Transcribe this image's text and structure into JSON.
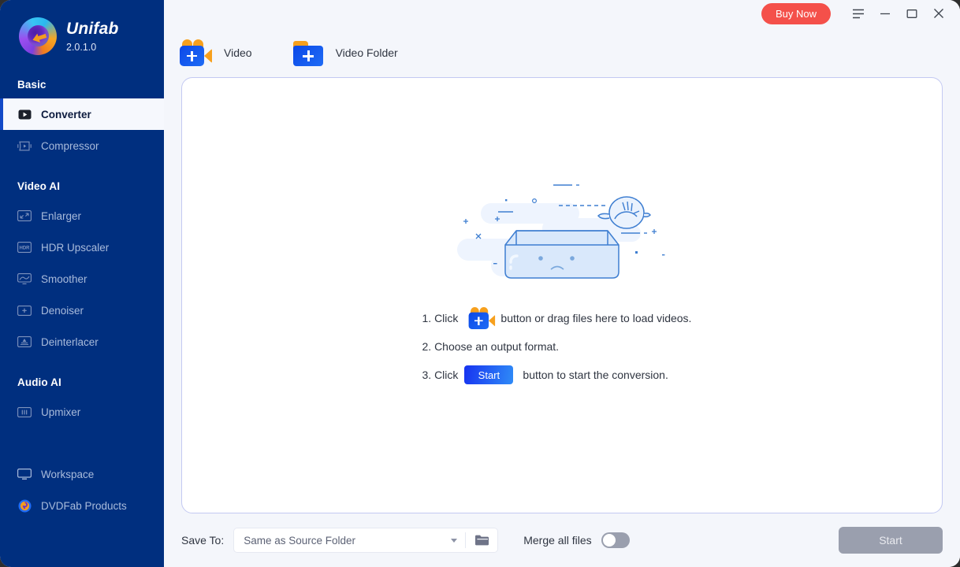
{
  "app": {
    "name": "Unifab",
    "version": "2.0.1.0"
  },
  "titlebar": {
    "buy_now_label": "Buy Now",
    "menu_icon": "hamburger-icon",
    "minimize_icon": "minimize-icon",
    "maximize_icon": "maximize-icon",
    "close_icon": "close-icon"
  },
  "sidebar": {
    "groups": [
      {
        "label": "Basic"
      },
      {
        "label": "Video AI"
      },
      {
        "label": "Audio AI"
      }
    ],
    "basic_items": [
      {
        "label": "Converter",
        "icon": "converter-icon",
        "active": true
      },
      {
        "label": "Compressor",
        "icon": "compressor-icon",
        "active": false
      }
    ],
    "video_ai_items": [
      {
        "label": "Enlarger",
        "icon": "enlarger-icon"
      },
      {
        "label": "HDR Upscaler",
        "icon": "hdr-upscaler-icon"
      },
      {
        "label": "Smoother",
        "icon": "smoother-icon"
      },
      {
        "label": "Denoiser",
        "icon": "denoiser-icon"
      },
      {
        "label": "Deinterlacer",
        "icon": "deinterlacer-icon"
      }
    ],
    "audio_ai_items": [
      {
        "label": "Upmixer",
        "icon": "upmixer-icon"
      }
    ],
    "bottom_items": [
      {
        "label": "Workspace",
        "icon": "monitor-icon"
      },
      {
        "label": "DVDFab Products",
        "icon": "dvdfab-icon"
      }
    ]
  },
  "toolbar": {
    "add_video_label": "Video",
    "add_video_folder_label": "Video Folder"
  },
  "dropzone": {
    "steps": [
      {
        "num": "1. Click",
        "tail": "button or drag files here to load videos."
      },
      {
        "num": "2. Choose an output format.",
        "tail": ""
      },
      {
        "num": "3. Click",
        "tail": "button to start the conversion."
      }
    ],
    "mini_start_label": "Start"
  },
  "bottombar": {
    "save_to_label": "Save To:",
    "path_value": "Same as Source Folder",
    "browse_icon": "folder-open-icon",
    "merge_label": "Merge all files",
    "merge_enabled": "off",
    "start_label": "Start"
  },
  "colors": {
    "sidebar_bg": "#002f7f",
    "accent": "#1249c7",
    "buy_now": "#f4504a",
    "page_bg": "#f4f6fb",
    "dropzone_border": "#c3c9f2",
    "disabled": "#9a9fae"
  }
}
